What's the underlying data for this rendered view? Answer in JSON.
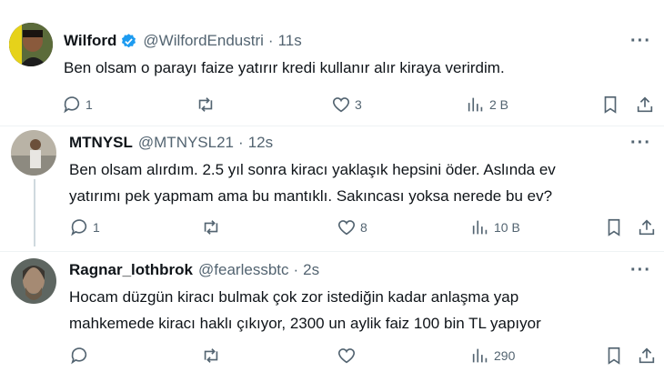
{
  "tweets": [
    {
      "name": "Wilford",
      "verified": true,
      "handle": "@WilfordEndustri",
      "dot": "·",
      "time": "11s",
      "more": "···",
      "lines": [
        "Ben olsam o parayı faize yatırır kredi kullanır alır kiraya verirdim."
      ],
      "replies": "1",
      "retweets": "",
      "likes": "3",
      "views": "2 B"
    },
    {
      "name": "MTNYSL",
      "verified": false,
      "handle": "@MTNYSL21",
      "dot": "·",
      "time": "12s",
      "more": "···",
      "lines": [
        "Ben olsam alırdım. 2.5 yıl sonra kiracı yaklaşık hepsini öder. Aslında ev",
        "yatırımı pek yapmam ama bu mantıklı. Sakıncası yoksa nerede bu ev?"
      ],
      "replies": "1",
      "retweets": "",
      "likes": "8",
      "views": "10 B"
    },
    {
      "name": "Ragnar_lothbrok",
      "verified": false,
      "handle": "@fearlessbtc",
      "dot": "·",
      "time": "2s",
      "more": "···",
      "lines": [
        "Hocam düzgün kiracı bulmak çok zor istediğin kadar anlaşma yap",
        "mahkemede kiracı haklı çıkıyor, 2300 un aylik faiz 100 bin TL yapıyor"
      ],
      "replies": "",
      "retweets": "",
      "likes": "",
      "views": "290"
    }
  ],
  "colors": {
    "text": "#0f1419",
    "muted": "#536471",
    "verified": "#1d9bf0",
    "thread": "#cfd9de"
  },
  "icons": [
    "reply-icon",
    "retweet-icon",
    "like-icon",
    "views-icon",
    "bookmark-icon",
    "share-icon"
  ]
}
